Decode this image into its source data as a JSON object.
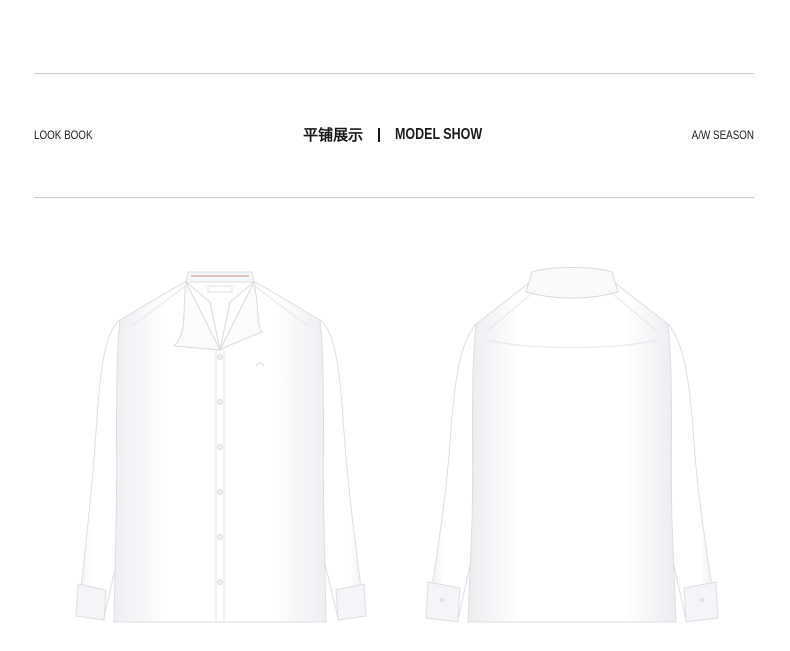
{
  "header": {
    "left_label": "LOOK BOOK",
    "title_cn": "平铺展示",
    "title_en": "MODEL SHOW",
    "right_label": "A/W SEASON"
  },
  "products": {
    "front_view": "shirt-front-icon",
    "back_view": "shirt-back-icon"
  },
  "colors": {
    "rule": "#cfcfcf",
    "text": "#1a1a1a",
    "shirt": "#ffffff",
    "shirt_shadow": "#e9eaee"
  }
}
